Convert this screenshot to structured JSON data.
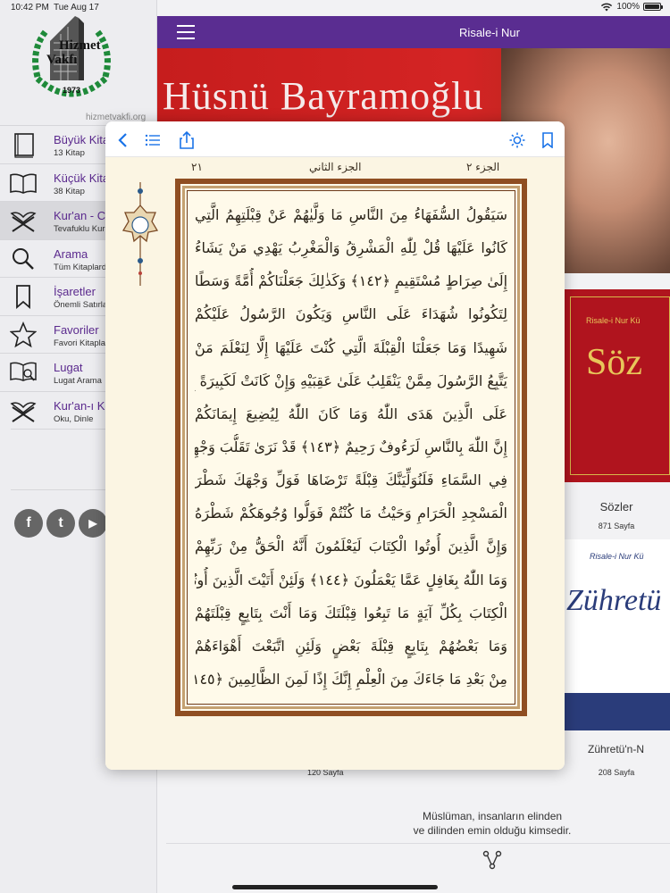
{
  "status": {
    "time": "10:42 PM",
    "date": "Tue Aug 17",
    "battery": "100%"
  },
  "sidebar": {
    "logo": {
      "line1": "Hizmet",
      "line2": "Vakfı",
      "year": "1973"
    },
    "site_url": "hizmetvakfi.org",
    "items": [
      {
        "title": "Büyük Kita",
        "sub": "13 Kitap",
        "icon": "book-closed-icon"
      },
      {
        "title": "Küçük Kita",
        "sub": "38 Kitap",
        "icon": "book-open-icon"
      },
      {
        "title": "Kur'an - Ce",
        "sub": "Tevafuklu Kur",
        "icon": "quran-stand-icon",
        "active": true
      },
      {
        "title": "Arama",
        "sub": "Tüm Kitaplarda",
        "icon": "search-icon"
      },
      {
        "title": "İşaretler",
        "sub": "Önemli Satırla",
        "icon": "bookmark-icon"
      },
      {
        "title": "Favoriler",
        "sub": "Favori Kitapla",
        "icon": "star-icon"
      },
      {
        "title": "Lugat",
        "sub": "Lugat Arama",
        "icon": "dictionary-icon"
      },
      {
        "title": "Kur'an-ı Ke",
        "sub": "Oku, Dinle",
        "icon": "quran-stand-icon"
      }
    ],
    "social": [
      "f",
      "t",
      "▶"
    ]
  },
  "main": {
    "title": "Risale-i Nur",
    "banner_name": "Hüsnü Bayramoğlu",
    "books": [
      {
        "cover_title": "Söz",
        "cover_sub": "Risale-i Nur Kü",
        "title": "Sözler",
        "pages": "871 Sayfa"
      },
      {
        "cover_title": "Zühretü",
        "cover_sub": "Risale-i Nur Kü",
        "title": "Zühretü'n-N",
        "pages": "208 Sayfa"
      }
    ],
    "left_pages": "120 Sayfa",
    "quote_line1": "Müslüman, insanların elinden",
    "quote_line2": "ve dilinden emin olduğu kimsedir."
  },
  "reader": {
    "header_right": "الجزء ٢",
    "header_center": "الجزء الثاني",
    "header_left": "٢١",
    "lines": [
      "سَيَقُولُ السُّفَهَاءُ مِنَ النَّاسِ مَا وَلَّيٰهُمْ عَنْ قِبْلَتِهِمُ الَّتِي",
      "كَانُوا عَلَيْهَا قُلْ لِلّٰهِ الْمَشْرِقُ وَالْمَغْرِبُ يَهْدِي مَنْ يَشَاءُ",
      "إِلَىٰ صِرَاطٍ مُسْتَقِيمٍ ﴿١٤٢﴾ وَكَذٰلِكَ جَعَلْنَاكُمْ أُمَّةً وَسَطًا",
      "لِتَكُونُوا شُهَدَاءَ عَلَى النَّاسِ وَيَكُونَ الرَّسُولُ عَلَيْكُمْ",
      "شَهِيدًا وَمَا جَعَلْنَا الْقِبْلَةَ الَّتِي كُنْتَ عَلَيْهَا إِلَّا لِنَعْلَمَ مَنْ",
      "يَتَّبِعُ الرَّسُولَ مِمَّنْ يَنْقَلِبُ عَلَىٰ عَقِبَيْهِ وَإِنْ كَانَتْ لَكَبِيرَةً إِلَّا",
      "عَلَى الَّذِينَ هَدَى اللّٰهُ وَمَا كَانَ اللّٰهُ لِيُضِيعَ إِيمَانَكُمْ",
      "إِنَّ اللّٰهَ بِالنَّاسِ لَرَءُوفٌ رَحِيمٌ ﴿١٤٣﴾ قَدْ نَرَىٰ تَقَلُّبَ وَجْهِكَ",
      "فِي السَّمَاءِ فَلَنُوَلِّيَنَّكَ قِبْلَةً تَرْضَاهَا فَوَلِّ وَجْهَكَ شَطْرَ",
      "الْمَسْجِدِ الْحَرَامِ وَحَيْثُ مَا كُنْتُمْ فَوَلُّوا وُجُوهَكُمْ شَطْرَهُ",
      "وَإِنَّ الَّذِينَ أُوتُوا الْكِتَابَ لَيَعْلَمُونَ أَنَّهُ الْحَقُّ مِنْ رَبِّهِمْ",
      "وَمَا اللّٰهُ بِغَافِلٍ عَمَّا يَعْمَلُونَ ﴿١٤٤﴾ وَلَئِنْ أَتَيْتَ الَّذِينَ أُوتُوا",
      "الْكِتَابَ بِكُلِّ آيَةٍ مَا تَبِعُوا قِبْلَتَكَ وَمَا أَنْتَ بِتَابِعٍ قِبْلَتَهُمْ",
      "وَمَا بَعْضُهُمْ بِتَابِعٍ قِبْلَةَ بَعْضٍ وَلَئِنِ اتَّبَعْتَ أَهْوَاءَهُمْ",
      "مِنْ بَعْدِ مَا جَاءَكَ مِنَ الْعِلْمِ إِنَّكَ إِذًا لَمِنَ الظَّالِمِينَ ﴿١٤٥﴾"
    ]
  }
}
